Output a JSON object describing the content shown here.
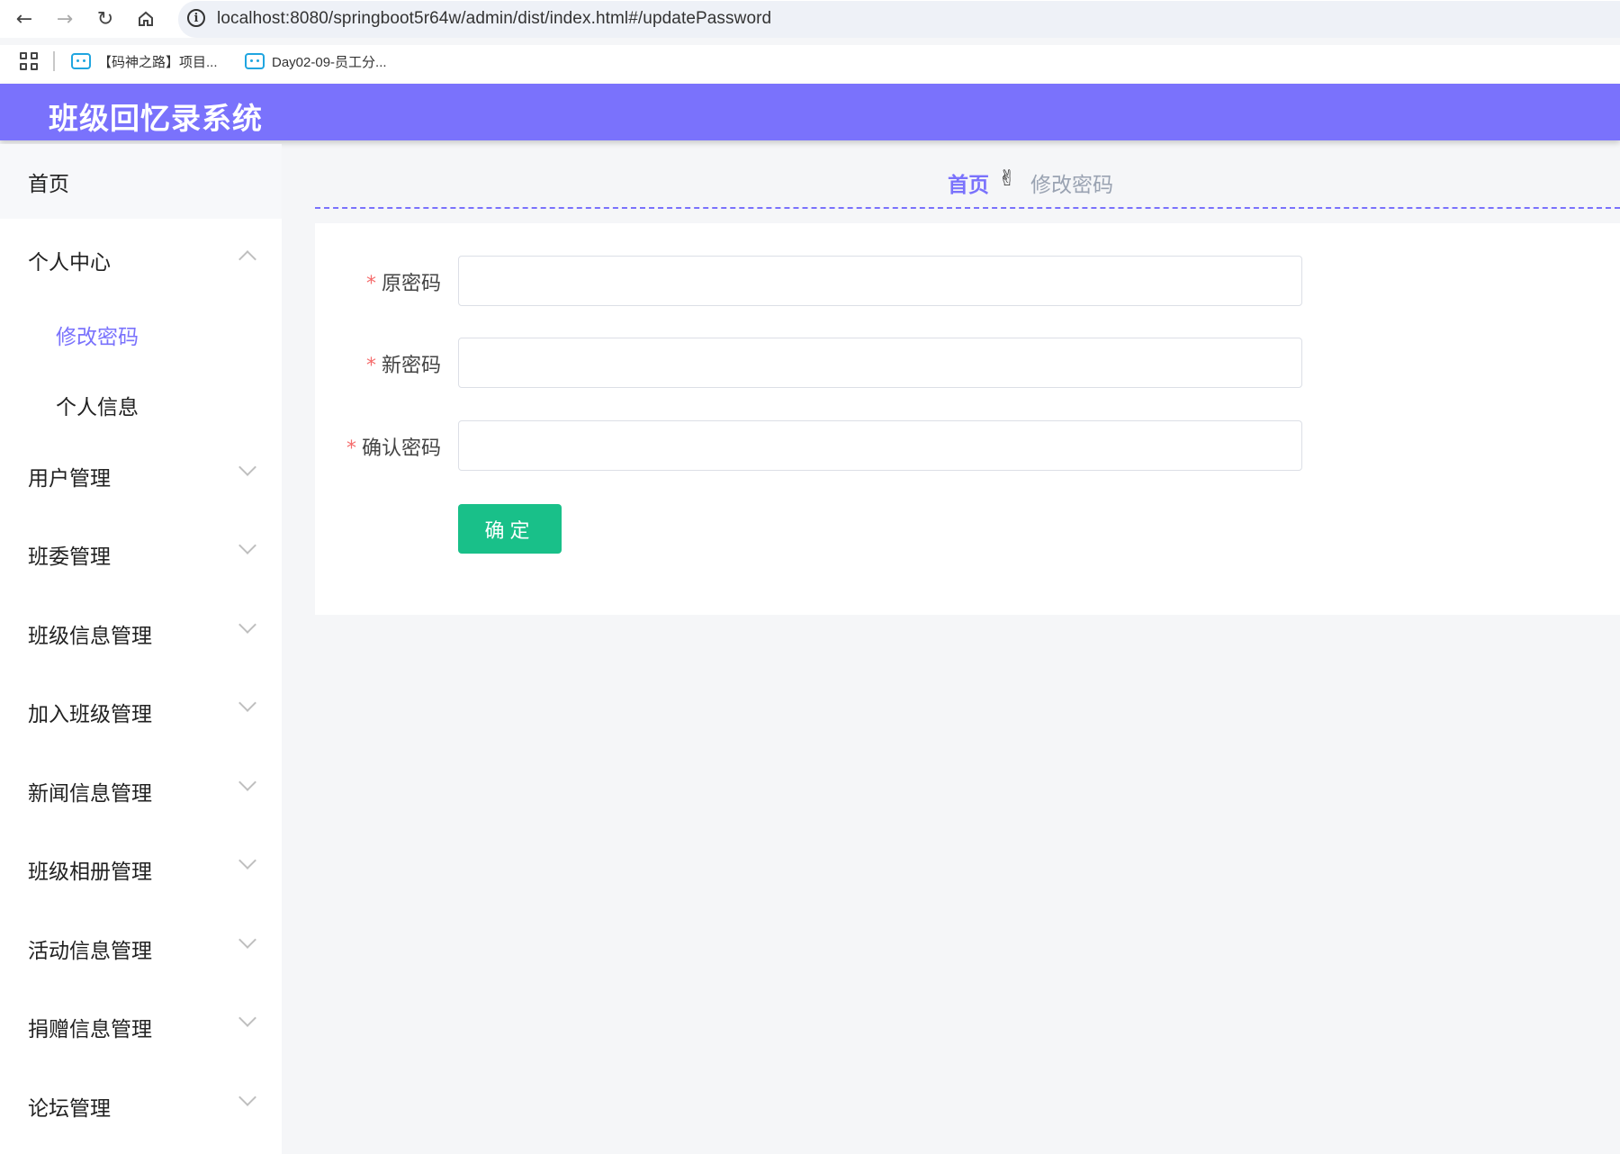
{
  "browser": {
    "url": "localhost:8080/springboot5r64w/admin/dist/index.html#/updatePassword",
    "bookmarks": [
      {
        "label": "【码神之路】项目..."
      },
      {
        "label": "Day02-09-员工分..."
      }
    ]
  },
  "header": {
    "title": "班级回忆录系统",
    "bg_color": "#7a72fc"
  },
  "sidebar": {
    "home": "首页",
    "personal_center": "个人中心",
    "sub_items": [
      {
        "label": "修改密码",
        "active": true
      },
      {
        "label": "个人信息",
        "active": false
      }
    ],
    "menus": [
      {
        "label": "用户管理"
      },
      {
        "label": "班委管理"
      },
      {
        "label": "班级信息管理"
      },
      {
        "label": "加入班级管理"
      },
      {
        "label": "新闻信息管理"
      },
      {
        "label": "班级相册管理"
      },
      {
        "label": "活动信息管理"
      },
      {
        "label": "捐赠信息管理"
      },
      {
        "label": "论坛管理"
      }
    ]
  },
  "breadcrumb": {
    "home": "首页",
    "separator": "✌",
    "current": "修改密码"
  },
  "form": {
    "required_mark": "*",
    "fields": [
      {
        "label": "原密码",
        "value": ""
      },
      {
        "label": "新密码",
        "value": ""
      },
      {
        "label": "确认密码",
        "value": ""
      }
    ],
    "submit_label": "确定",
    "submit_color": "#19c089"
  }
}
